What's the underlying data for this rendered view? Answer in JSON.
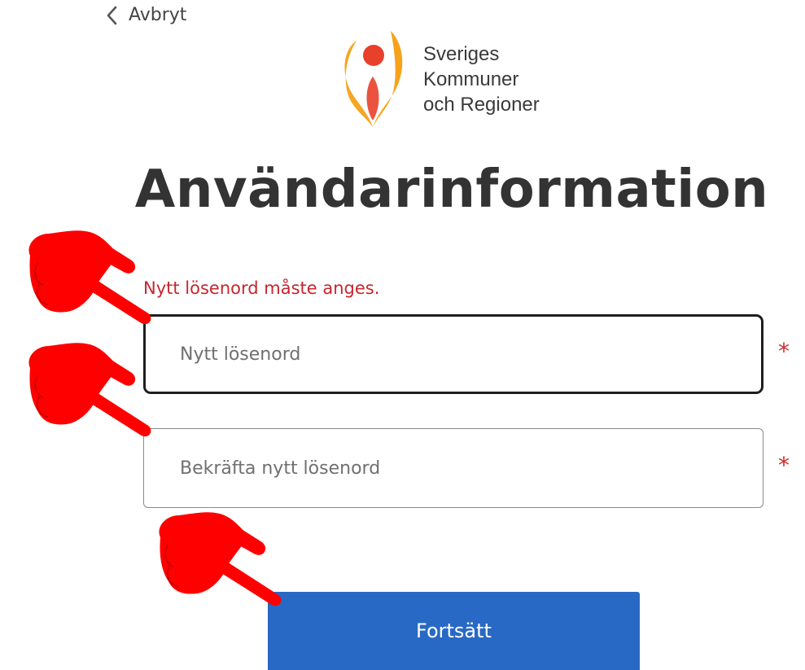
{
  "nav": {
    "back_label": "Avbryt"
  },
  "logo": {
    "line1": "Sveriges",
    "line2": "Kommuner",
    "line3": "och Regioner"
  },
  "page": {
    "title": "Användarinformation"
  },
  "form": {
    "error_message": "Nytt lösenord måste anges.",
    "new_password": {
      "placeholder": "Nytt lösenord",
      "value": ""
    },
    "confirm_password": {
      "placeholder": "Bekräfta nytt lösenord",
      "value": ""
    },
    "required_marker": "*",
    "submit_label": "Fortsätt"
  },
  "colors": {
    "primary_button": "#2869c5",
    "error": "#c6262e",
    "annotation_hand": "#ff0000",
    "logo_orange": "#f5a623",
    "logo_red": "#e8402a"
  },
  "annotations": {
    "icon": "pointing-hand-icon"
  }
}
